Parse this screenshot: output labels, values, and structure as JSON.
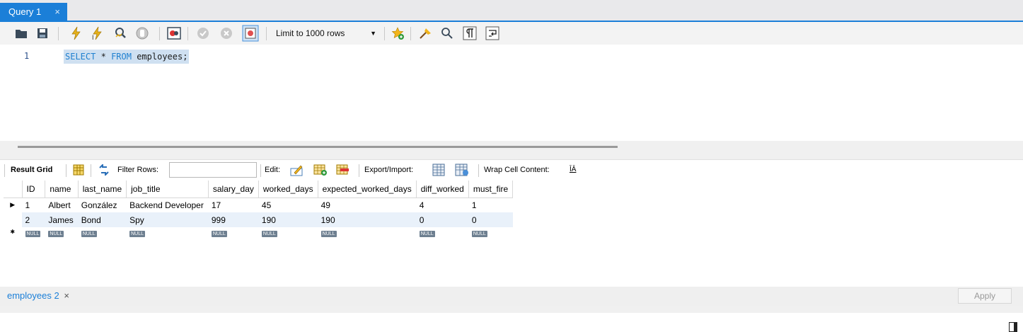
{
  "query_tab": {
    "title": "Query 1",
    "close": "×"
  },
  "toolbar": {
    "limit_label": "Limit to 1000 rows",
    "limit_arrow": "▼",
    "icons": [
      "open-folder-icon",
      "save-icon",
      "execute-icon",
      "execute-current-icon",
      "explain-icon",
      "stop-icon",
      "toggle-error-icon",
      "commit-icon",
      "rollback-icon",
      "autocommit-icon",
      "add-favorite-icon",
      "beautify-icon",
      "find-icon",
      "invisible-chars-icon",
      "word-wrap-icon"
    ]
  },
  "editor": {
    "line_number": "1",
    "sql_keyword_1": "SELECT",
    "sql_star": "*",
    "sql_keyword_2": "FROM",
    "sql_table": "employees;"
  },
  "result_toolbar": {
    "result_grid": "Result Grid",
    "filter_rows": "Filter Rows:",
    "edit": "Edit:",
    "export_import": "Export/Import:",
    "wrap_cell": "Wrap Cell Content:",
    "wrap_icon_glyph": "ĪĀ"
  },
  "grid": {
    "columns": [
      "ID",
      "name",
      "last_name",
      "job_title",
      "salary_day",
      "worked_days",
      "expected_worked_days",
      "diff_worked",
      "must_fire"
    ],
    "rows": [
      [
        "1",
        "Albert",
        "González",
        "Backend Developer",
        "17",
        "45",
        "49",
        "4",
        "1"
      ],
      [
        "2",
        "James",
        "Bond",
        "Spy",
        "999",
        "190",
        "190",
        "0",
        "0"
      ]
    ],
    "null_label": "NULL",
    "current_marker": "▶",
    "new_marker": "✱"
  },
  "bottom": {
    "result_tab": "employees 2",
    "result_tab_close": "×",
    "apply": "Apply"
  },
  "colors": {
    "accent": "#1b7fd8",
    "selection": "#cfe0f1",
    "alt_row": "#e9f1fa"
  }
}
